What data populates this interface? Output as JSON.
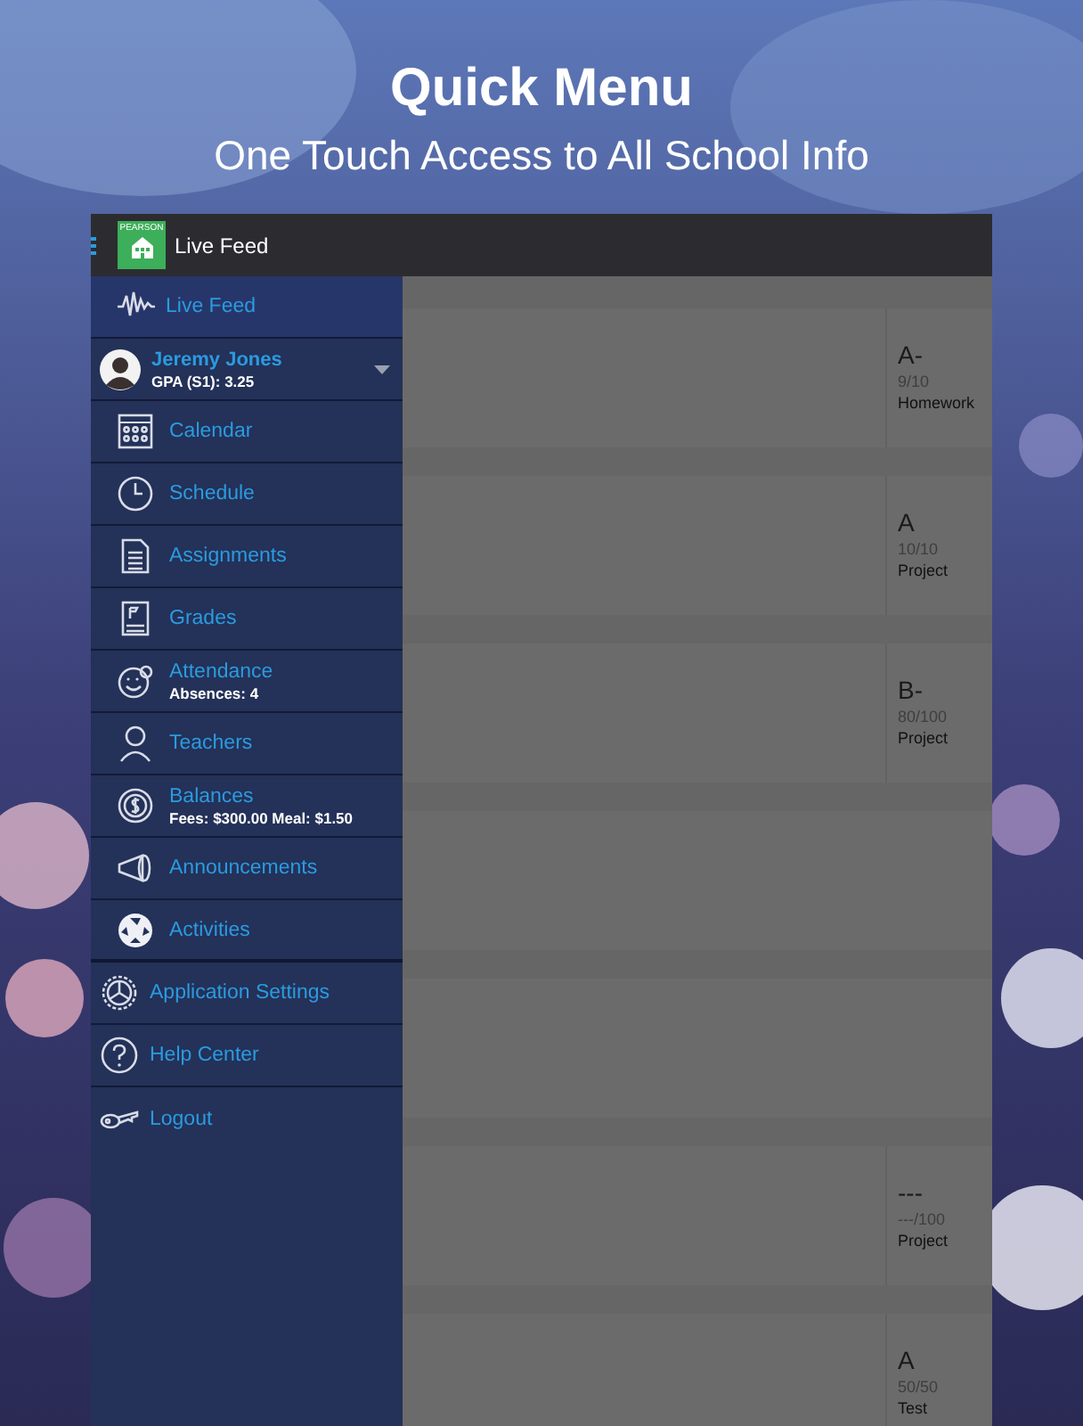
{
  "headline": {
    "title": "Quick Menu",
    "subtitle": "One Touch Access to All School Info"
  },
  "app_bar": {
    "logo_text": "PEARSON",
    "title": "Live Feed"
  },
  "drawer": [
    {
      "kind": "item",
      "label": "Live Feed",
      "selected": true
    },
    {
      "kind": "profile",
      "label": "Jeremy Jones",
      "detail": "GPA (S1): 3.25"
    },
    {
      "kind": "item",
      "label": "Calendar",
      "selected": false
    },
    {
      "kind": "item",
      "label": "Schedule",
      "selected": false
    },
    {
      "kind": "item",
      "label": "Assignments",
      "selected": false
    },
    {
      "kind": "item",
      "label": "Grades",
      "selected": false
    },
    {
      "kind": "item",
      "label": "Attendance",
      "detail": "Absences: 4",
      "selected": false
    },
    {
      "kind": "item",
      "label": "Teachers",
      "selected": false
    },
    {
      "kind": "item",
      "label": "Balances",
      "detail": "Fees: $300.00 Meal: $1.50",
      "selected": false
    },
    {
      "kind": "item",
      "label": "Announcements",
      "selected": false
    },
    {
      "kind": "item",
      "label": "Activities",
      "selected": false
    },
    {
      "kind": "setting",
      "label": "Application Settings"
    },
    {
      "kind": "setting",
      "label": "Help Center"
    },
    {
      "kind": "setting",
      "label": "Logout"
    }
  ],
  "feed": [
    {
      "kind": "grade",
      "grade": "A-",
      "score": "9/10",
      "type": "Homework"
    },
    {
      "kind": "grade",
      "grade": "A",
      "score": "10/10",
      "type": "Project"
    },
    {
      "kind": "grade",
      "grade": "B-",
      "score": "80/100",
      "type": "Project"
    },
    {
      "kind": "empty"
    },
    {
      "kind": "empty"
    },
    {
      "kind": "grade",
      "grade": "---",
      "score": "---/100",
      "type": "Project"
    },
    {
      "kind": "grade",
      "grade": "A",
      "score": "50/50",
      "type": "Test"
    }
  ]
}
